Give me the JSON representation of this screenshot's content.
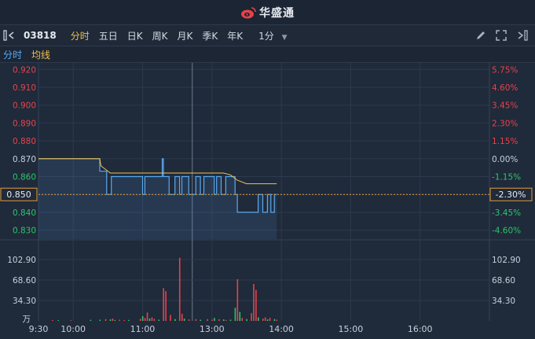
{
  "app": {
    "brand": "华盛通"
  },
  "toolbar": {
    "stock_code": "03818",
    "periods": [
      "分时",
      "五日",
      "日K",
      "周K",
      "月K",
      "季K",
      "年K"
    ],
    "active_period": "分时",
    "minute_select": "1分"
  },
  "legend": {
    "line_label": "分时",
    "avg_label": "均线"
  },
  "colors": {
    "up": "#e8424a",
    "down": "#2ec46b",
    "price_line": "#5aa9f0",
    "avg_line": "#f2c14e",
    "neutral": "#c8d0dc"
  },
  "chart_data": {
    "type": "line",
    "price_ticks": [
      "0.920",
      "0.910",
      "0.900",
      "0.890",
      "0.880",
      "0.870",
      "0.860",
      "0.850",
      "0.840",
      "0.830"
    ],
    "pct_ticks": [
      "5.75%",
      "4.60%",
      "3.45%",
      "2.30%",
      "1.15%",
      "0.00%",
      "-1.15%",
      "-2.30%",
      "-3.45%",
      "-4.60%"
    ],
    "current_price": "0.850",
    "current_pct": "-2.30%",
    "prev_close": 0.87,
    "ylim": [
      0.825,
      0.921
    ],
    "time_ticks": [
      "9:30",
      "10:00",
      "11:00",
      "13:00",
      "14:00",
      "15:00",
      "16:00"
    ],
    "volume_ticks": [
      "102.90",
      "68.60",
      "34.30"
    ],
    "volume_unit": "万",
    "volume_max": 102.9,
    "price_series": [
      [
        0,
        0.87
      ],
      [
        53,
        0.87
      ],
      [
        53,
        0.863
      ],
      [
        59,
        0.863
      ],
      [
        59,
        0.85
      ],
      [
        63,
        0.85
      ],
      [
        63,
        0.86
      ],
      [
        90,
        0.86
      ],
      [
        90,
        0.85
      ],
      [
        92,
        0.85
      ],
      [
        92,
        0.86
      ],
      [
        107,
        0.86
      ],
      [
        107,
        0.87
      ],
      [
        108,
        0.87
      ],
      [
        108,
        0.86
      ],
      [
        113,
        0.86
      ],
      [
        113,
        0.85
      ],
      [
        118,
        0.85
      ],
      [
        118,
        0.86
      ],
      [
        122,
        0.86
      ],
      [
        122,
        0.85
      ],
      [
        124,
        0.85
      ],
      [
        124,
        0.86
      ],
      [
        130,
        0.86
      ],
      [
        130,
        0.85
      ],
      [
        136,
        0.85
      ],
      [
        136,
        0.86
      ],
      [
        140,
        0.86
      ],
      [
        140,
        0.85
      ],
      [
        143,
        0.85
      ],
      [
        143,
        0.86
      ],
      [
        152,
        0.86
      ],
      [
        152,
        0.85
      ],
      [
        154,
        0.85
      ],
      [
        154,
        0.86
      ],
      [
        158,
        0.86
      ],
      [
        158,
        0.85
      ],
      [
        162,
        0.85
      ],
      [
        162,
        0.86
      ],
      [
        170,
        0.86
      ],
      [
        170,
        0.85
      ],
      [
        172,
        0.85
      ],
      [
        172,
        0.84
      ],
      [
        190,
        0.84
      ],
      [
        190,
        0.85
      ],
      [
        194,
        0.85
      ],
      [
        194,
        0.84
      ],
      [
        198,
        0.84
      ],
      [
        198,
        0.85
      ],
      [
        201,
        0.85
      ],
      [
        201,
        0.84
      ],
      [
        204,
        0.84
      ],
      [
        204,
        0.85
      ],
      [
        206,
        0.85
      ]
    ],
    "avg_series": [
      [
        0,
        0.87
      ],
      [
        53,
        0.87
      ],
      [
        54,
        0.866
      ],
      [
        58,
        0.864
      ],
      [
        62,
        0.862
      ],
      [
        90,
        0.862
      ],
      [
        120,
        0.862
      ],
      [
        150,
        0.862
      ],
      [
        160,
        0.862
      ],
      [
        166,
        0.861
      ],
      [
        172,
        0.858
      ],
      [
        180,
        0.856
      ],
      [
        206,
        0.856
      ]
    ],
    "volume_bars": [
      [
        12,
        1.5,
        "u"
      ],
      [
        17,
        1.2,
        "d"
      ],
      [
        28,
        1.0,
        "u"
      ],
      [
        45,
        1.8,
        "d"
      ],
      [
        53,
        2.0,
        "d"
      ],
      [
        58,
        3.0,
        "u"
      ],
      [
        62,
        2.5,
        "d"
      ],
      [
        64,
        4.0,
        "u"
      ],
      [
        66,
        1.5,
        "d"
      ],
      [
        70,
        2.0,
        "u"
      ],
      [
        74,
        1.3,
        "u"
      ],
      [
        78,
        1.6,
        "d"
      ],
      [
        88,
        3.5,
        "u"
      ],
      [
        90,
        8.0,
        "d"
      ],
      [
        92,
        5.0,
        "u"
      ],
      [
        94,
        14.0,
        "u"
      ],
      [
        96,
        4.0,
        "d"
      ],
      [
        98,
        6.0,
        "u"
      ],
      [
        100,
        3.5,
        "u"
      ],
      [
        104,
        2.0,
        "d"
      ],
      [
        108,
        55.0,
        "u"
      ],
      [
        110,
        50.0,
        "u"
      ],
      [
        114,
        10.0,
        "u"
      ],
      [
        118,
        3.0,
        "d"
      ],
      [
        122,
        106.0,
        "u"
      ],
      [
        124,
        12.0,
        "u"
      ],
      [
        126,
        4.0,
        "d"
      ],
      [
        130,
        2.5,
        "u"
      ],
      [
        136,
        3.0,
        "u"
      ],
      [
        140,
        2.0,
        "d"
      ],
      [
        146,
        3.0,
        "u"
      ],
      [
        150,
        2.0,
        "u"
      ],
      [
        152,
        5.0,
        "d"
      ],
      [
        156,
        3.0,
        "u"
      ],
      [
        160,
        2.5,
        "d"
      ],
      [
        162,
        1.5,
        "u"
      ],
      [
        166,
        2.0,
        "d"
      ],
      [
        170,
        22.0,
        "d"
      ],
      [
        172,
        70.0,
        "u"
      ],
      [
        174,
        15.0,
        "d"
      ],
      [
        176,
        5.0,
        "u"
      ],
      [
        180,
        3.0,
        "d"
      ],
      [
        184,
        13.0,
        "u"
      ],
      [
        186,
        62.0,
        "u"
      ],
      [
        188,
        52.0,
        "u"
      ],
      [
        190,
        6.0,
        "d"
      ],
      [
        194,
        4.0,
        "u"
      ],
      [
        196,
        6.0,
        "u"
      ],
      [
        198,
        2.5,
        "d"
      ],
      [
        200,
        5.0,
        "u"
      ],
      [
        204,
        3.0,
        "d"
      ],
      [
        206,
        2.0,
        "u"
      ]
    ]
  }
}
